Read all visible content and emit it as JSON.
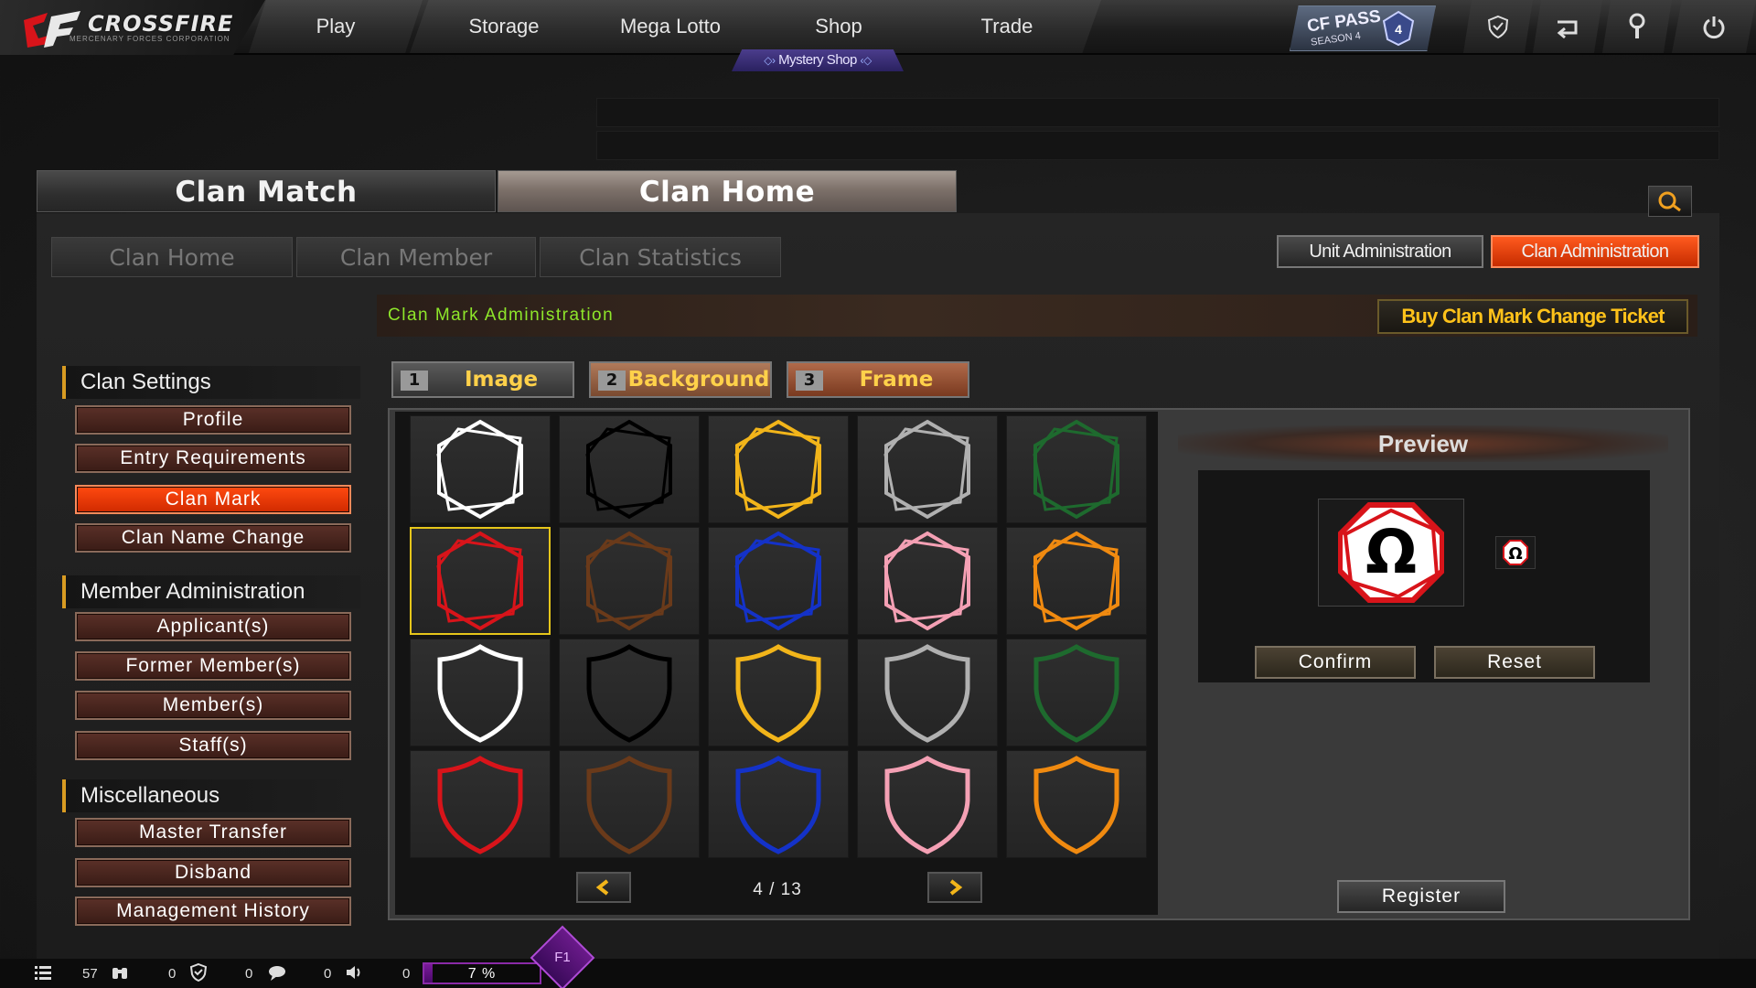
{
  "app": {
    "logo_text": "CROSSFIRE",
    "logo_sub": "MERCENARY FORCES CORPORATION"
  },
  "topnav": {
    "items": [
      "Play",
      "Storage",
      "Mega Lotto",
      "Shop",
      "Trade"
    ],
    "mystery_shop": "Mystery Shop",
    "cf_pass_title": "CF PASS",
    "cf_pass_season": "SEASON 4",
    "icons": [
      "shield-icon",
      "return-icon",
      "wrench-icon",
      "power-icon"
    ]
  },
  "clan_tabs": {
    "clan_match": "Clan Match",
    "clan_home": "Clan Home",
    "active": "clan_home"
  },
  "sub_tabs": [
    "Clan Home",
    "Clan Member",
    "Clan Statistics"
  ],
  "admin_buttons": {
    "unit": "Unit Administration",
    "clan": "Clan Administration",
    "active": "clan"
  },
  "header": {
    "title": "Clan Mark Administration",
    "buy_ticket": "Buy Clan Mark Change Ticket"
  },
  "menu": {
    "sections": [
      {
        "title": "Clan Settings",
        "items": [
          "Profile",
          "Entry Requirements",
          "Clan Mark",
          "Clan Name Change"
        ]
      },
      {
        "title": "Member Administration",
        "items": [
          "Applicant(s)",
          "Former Member(s)",
          "Member(s)",
          "Staff(s)"
        ]
      },
      {
        "title": "Miscellaneous",
        "items": [
          "Master Transfer",
          "Disband",
          "Management History"
        ]
      }
    ],
    "active_item": "Clan Mark"
  },
  "type_tabs": [
    {
      "num": "1",
      "label": "Image"
    },
    {
      "num": "2",
      "label": "Background"
    },
    {
      "num": "3",
      "label": "Frame"
    }
  ],
  "grid": {
    "rows": [
      {
        "shape": "hexagon",
        "colors": [
          "#ffffff",
          "#000000",
          "#f2b51a",
          "#b0b0b0",
          "#1e6a2e"
        ]
      },
      {
        "shape": "hexagon",
        "colors": [
          "#d8141a",
          "#6a3a1a",
          "#1432c8",
          "#f4a0b4",
          "#f08a10"
        ]
      },
      {
        "shape": "shield",
        "colors": [
          "#ffffff",
          "#000000",
          "#f2b51a",
          "#b0b0b0",
          "#1e6a2e"
        ]
      },
      {
        "shape": "shield",
        "colors": [
          "#d8141a",
          "#6a3a1a",
          "#1432c8",
          "#f4a0b4",
          "#f08a10"
        ]
      }
    ],
    "selected": {
      "row": 1,
      "col": 0
    },
    "page": "4 / 13"
  },
  "preview": {
    "title": "Preview",
    "symbol": "Ω",
    "confirm": "Confirm",
    "reset": "Reset",
    "register": "Register"
  },
  "bottombar": {
    "stats": [
      "57",
      "0",
      "0",
      "0",
      "0"
    ],
    "progress": "7 %",
    "progress_value": 0.07,
    "f1": "F1"
  }
}
